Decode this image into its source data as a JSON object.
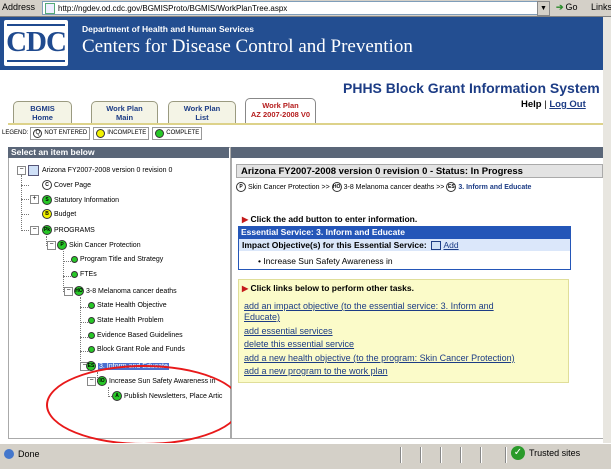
{
  "browser": {
    "address_label": "Address",
    "url": "http://ngdev.od.cdc.gov/BGMISProto/BGMIS/WorkPlanTree.aspx",
    "go_label": "Go",
    "links_label": "Links"
  },
  "header": {
    "logo_text": "CDC",
    "department": "Department of Health and Human Services",
    "agency": "Centers for Disease Control and Prevention",
    "system_title": "PHHS Block Grant Information System",
    "help": "Help",
    "separator": "|",
    "logout": "Log Out",
    "brand_color": "#234e91"
  },
  "tabs": [
    {
      "line1": "BGMIS",
      "line2": "Home",
      "active": false
    },
    {
      "line1": "Work Plan",
      "line2": "Main",
      "active": false
    },
    {
      "line1": "Work Plan",
      "line2": "List",
      "active": false
    },
    {
      "line1": "Work Plan",
      "line2": "AZ 2007-2008 V0",
      "active": true
    }
  ],
  "legend": {
    "label": "LEGEND:",
    "items": [
      {
        "letter": "Q",
        "label": "NOT ENTERED",
        "color": "#ffffff"
      },
      {
        "letter": "",
        "label": "INCOMPLETE",
        "color": "#f2f200"
      },
      {
        "letter": "",
        "label": "COMPLETE",
        "color": "#27c827"
      }
    ]
  },
  "left_panel": {
    "title": "Select an item below",
    "tree": [
      {
        "label": "Arizona FY2007-2008 version 0 revision 0",
        "badge": "",
        "status": "doc"
      },
      {
        "label": "Cover Page",
        "badge": "C",
        "status": "white"
      },
      {
        "label": "Statutory Information",
        "badge": "S",
        "status": "green"
      },
      {
        "label": "Budget",
        "badge": "B",
        "status": "yellow"
      },
      {
        "label": "PROGRAMS",
        "badge": "Pk",
        "status": "green"
      },
      {
        "label": "Skin Cancer Protection",
        "badge": "P",
        "status": "green"
      },
      {
        "label": "Program Title and Strategy",
        "badge": "",
        "status": "green"
      },
      {
        "label": "FTEs",
        "badge": "",
        "status": "green"
      },
      {
        "label": "3-8 Melanoma cancer deaths",
        "badge": "HO",
        "status": "green"
      },
      {
        "label": "State Health Objective",
        "badge": "",
        "status": "green"
      },
      {
        "label": "State Health Problem",
        "badge": "",
        "status": "green"
      },
      {
        "label": "Evidence Based Guidelines",
        "badge": "",
        "status": "green"
      },
      {
        "label": "Block Grant Role and Funds",
        "badge": "",
        "status": "green"
      },
      {
        "label": "3. Inform and Educate",
        "badge": "ES",
        "status": "green"
      },
      {
        "label": "Increase Sun Safety Awareness in",
        "badge": "IO",
        "status": "green"
      },
      {
        "label": "Publish Newsletters, Place Artic",
        "badge": "A",
        "status": "green"
      }
    ]
  },
  "right_panel": {
    "title": "Arizona FY2007-2008 version 0 revision 0 - Status: In Progress",
    "crumbs": [
      {
        "badge": "P",
        "label": "Skin Cancer Protection"
      },
      {
        "badge": "HO",
        "label": "3-8 Melanoma cancer deaths"
      },
      {
        "badge": "ES",
        "label": "3. Inform and Educate"
      }
    ],
    "crumb_sep": ">>",
    "add_hint": "Click the add button to enter information.",
    "es_label": "Essential Service:",
    "es_value": "3. Inform and Educate",
    "impact_label": "Impact Objective(s) for this Essential Service:",
    "add_link": "Add",
    "impact_item": "Increase Sun Safety Awareness in",
    "tasks_hint": "Click links below to perform other tasks.",
    "tasks": [
      "add an impact objective (to the essential service: 3. Inform and",
      "Educate)",
      "add essential services",
      "delete this essential service",
      "add a new health objective (to the program: Skin Cancer Protection)",
      "add a new program to the work plan"
    ]
  },
  "statusbar": {
    "status": "Done",
    "zone": "Trusted sites"
  }
}
